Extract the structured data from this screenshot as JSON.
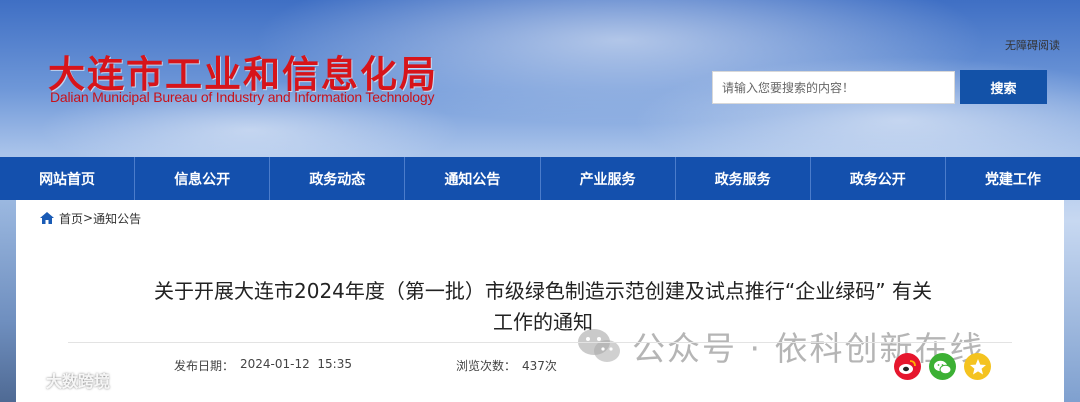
{
  "header": {
    "logo_cn": "大连市工业和信息化局",
    "logo_en": "Dalian Municipal Bureau of Industry and Information Technology",
    "accessibility": "无障碍阅读",
    "search_placeholder": "请输入您要搜索的内容！",
    "search_button": "搜索"
  },
  "nav": {
    "items": [
      "网站首页",
      "信息公开",
      "政务动态",
      "通知公告",
      "产业服务",
      "政务服务",
      "政务公开",
      "党建工作"
    ]
  },
  "breadcrumb": {
    "home": "首页",
    "separator": ">",
    "current": "通知公告"
  },
  "article": {
    "title_line1": "关于开展大连市2024年度（第一批）市级绿色制造示范创建及试点推行“企业绿码” 有关",
    "title_line2": "工作的通知",
    "publish_label": "发布日期：",
    "publish_value": "2024-01-12  15:35",
    "views_label": "浏览次数：",
    "views_value": "437次"
  },
  "watermark": {
    "text": "公众号 · 依科创新在线",
    "corner_text": "大数跨境"
  },
  "share": {
    "icons": [
      "weibo-icon",
      "wechat-icon",
      "qzone-icon"
    ]
  },
  "colors": {
    "nav_bg": "#1450ad",
    "logo_red": "#d7141a",
    "button_blue": "#1352a8"
  }
}
